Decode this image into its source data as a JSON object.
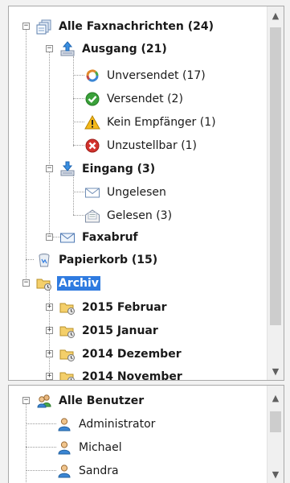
{
  "tree": {
    "all_fax": "Alle Faxnachrichten (24)",
    "outgoing": "Ausgang (21)",
    "unsent": "Unversendet (17)",
    "sent": "Versendet (2)",
    "no_recipient": "Kein Empfänger (1)",
    "undeliverable": "Unzustellbar (1)",
    "incoming": "Eingang (3)",
    "unread": "Ungelesen",
    "read": "Gelesen (3)",
    "fax_poll": "Faxabruf",
    "trash": "Papierkorb (15)",
    "archive": "Archiv",
    "archive_items": [
      "2015 Februar",
      "2015 Januar",
      "2014 Dezember",
      "2014 November"
    ]
  },
  "users": {
    "all_users": "Alle Benutzer",
    "items": [
      "Administrator",
      "Michael",
      "Sandra"
    ]
  },
  "colors": {
    "selection": "#2f7be0",
    "tree_line": "#9a9a9a",
    "scroll_thumb": "#cdcdcd"
  }
}
